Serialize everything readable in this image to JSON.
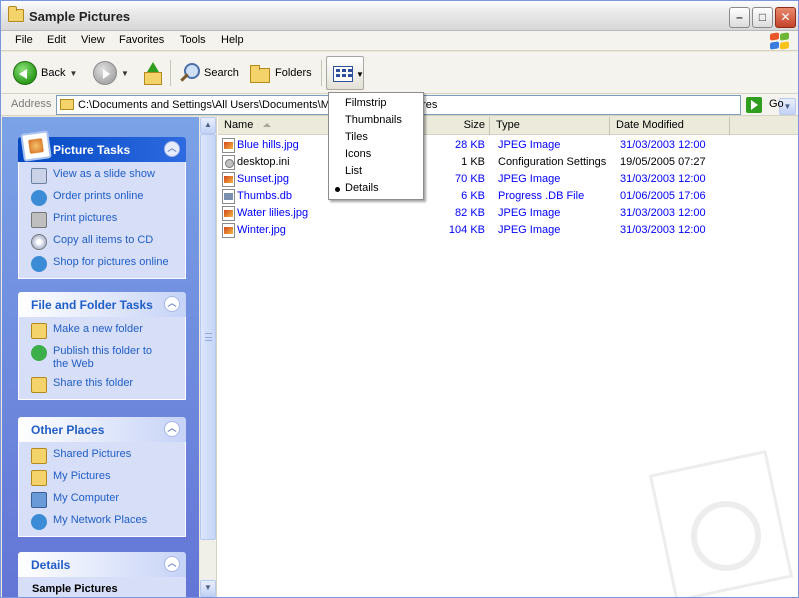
{
  "window": {
    "title": "Sample Pictures"
  },
  "menubar": {
    "items": [
      "File",
      "Edit",
      "View",
      "Favorites",
      "Tools",
      "Help"
    ]
  },
  "toolbar": {
    "back_label": "Back",
    "search_label": "Search",
    "folders_label": "Folders"
  },
  "address": {
    "label": "Address",
    "path": "C:\\Documents and Settings\\All Users\\Documents\\My",
    "path_tail": "ictures",
    "go_label": "Go"
  },
  "views_menu": {
    "items": [
      "Filmstrip",
      "Thumbnails",
      "Tiles",
      "Icons",
      "List",
      "Details"
    ],
    "selected": "Details"
  },
  "tasks": {
    "picture": {
      "title": "Picture Tasks",
      "links": [
        "View as a slide show",
        "Order prints online",
        "Print pictures",
        "Copy all items to CD",
        "Shop for pictures online"
      ]
    },
    "file_folder": {
      "title": "File and Folder Tasks",
      "links": [
        "Make a new folder",
        "Publish this folder to the Web",
        "Share this folder"
      ]
    },
    "other_places": {
      "title": "Other Places",
      "links": [
        "Shared Pictures",
        "My Pictures",
        "My Computer",
        "My Network Places"
      ]
    },
    "details": {
      "title": "Details",
      "subtitle": "Sample Pictures"
    }
  },
  "columns": {
    "name": "Name",
    "size": "Size",
    "type": "Type",
    "date": "Date Modified"
  },
  "files": [
    {
      "name": "Blue hills.jpg",
      "size": "28 KB",
      "type": "JPEG Image",
      "date": "31/03/2003 12:00",
      "kind": "jpg",
      "color": "#0000ff"
    },
    {
      "name": "desktop.ini",
      "size": "1 KB",
      "type": "Configuration Settings",
      "date": "19/05/2005 07:27",
      "kind": "ini",
      "color": "#000000"
    },
    {
      "name": "Sunset.jpg",
      "size": "70 KB",
      "type": "JPEG Image",
      "date": "31/03/2003 12:00",
      "kind": "jpg",
      "color": "#0000ff"
    },
    {
      "name": "Thumbs.db",
      "size": "6 KB",
      "type": "Progress .DB File",
      "date": "01/06/2005 17:06",
      "kind": "db",
      "color": "#0000ff"
    },
    {
      "name": "Water lilies.jpg",
      "size": "82 KB",
      "type": "JPEG Image",
      "date": "31/03/2003 12:00",
      "kind": "jpg",
      "color": "#0000ff"
    },
    {
      "name": "Winter.jpg",
      "size": "104 KB",
      "type": "JPEG Image",
      "date": "31/03/2003 12:00",
      "kind": "jpg",
      "color": "#0000ff"
    }
  ]
}
